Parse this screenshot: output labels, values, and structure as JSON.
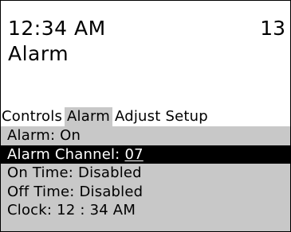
{
  "status": {
    "time": "12:34 AM",
    "channel": "13"
  },
  "screen_title": "Alarm",
  "tabs": [
    {
      "label": "Controls",
      "active": false
    },
    {
      "label": "Alarm",
      "active": true
    },
    {
      "label": "Adjust",
      "active": false
    },
    {
      "label": "Setup",
      "active": false
    }
  ],
  "menu": {
    "items": [
      {
        "label": "Alarm:",
        "value": "On"
      },
      {
        "label": "Alarm Channel:",
        "value": "07",
        "selected": true
      },
      {
        "label": "On Time:",
        "value": "Disabled"
      },
      {
        "label": "Off Time:",
        "value": "Disabled"
      },
      {
        "label": "Clock:",
        "value": "12 : 34 AM"
      }
    ]
  },
  "colors": {
    "background": "#ffffff",
    "menu_background": "#c8c8c8",
    "highlight": "#000000"
  }
}
